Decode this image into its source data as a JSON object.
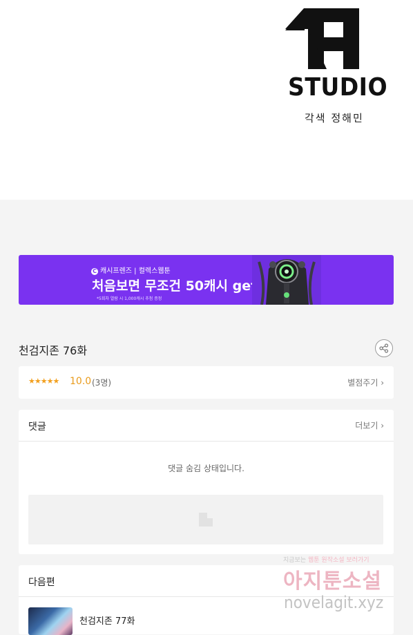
{
  "header": {
    "studio_name": "STUDIO",
    "credit": "각색 정해민"
  },
  "banner": {
    "brand_icon": "C",
    "brand": "캐시프렌즈 | 컬렉스웹툰",
    "headline": "처음보면 무조건 50캐시 get!!",
    "fine_print": "*5회차 열람 시 1,000캐시 추첨 증정"
  },
  "episode": {
    "title": "천검지존 76화"
  },
  "rating": {
    "stars": "★★★★★",
    "score": "10.0",
    "count": "(3명)",
    "rate_label": "별점주기 ›"
  },
  "comments": {
    "heading": "댓글",
    "more_label": "더보기 ›",
    "hidden_message": "댓글 숨김 상태입니다."
  },
  "next_episode": {
    "heading": "다음편",
    "title": "천검지존 77화"
  },
  "watermark": {
    "line1_gray": "지금보는",
    "line1_pink": "웹툰 원작소설 보러가기",
    "line2": "아지툰소설",
    "line3": "novelagit.xyz"
  },
  "colors": {
    "banner_bg": "#7a32f0",
    "star": "#f2a01f",
    "page_bg": "#f4f4f4"
  }
}
